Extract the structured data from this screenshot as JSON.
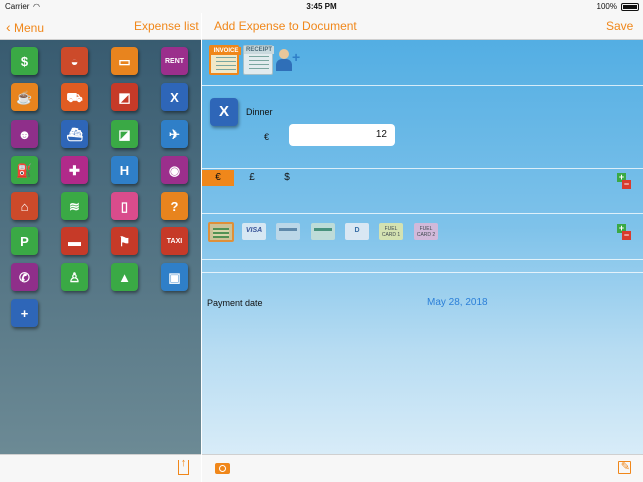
{
  "status": {
    "carrier": "Carrier",
    "time": "3:45 PM",
    "battery": "100%"
  },
  "left_nav": {
    "back_label": "Menu",
    "title": "Expense list"
  },
  "right_nav": {
    "title": "Add Expense to Document",
    "save_label": "Save"
  },
  "expense": {
    "name": "Dinner",
    "currency_symbol": "€",
    "amount": "12"
  },
  "documents": {
    "invoice_label": "INVOICE",
    "receipt_label": "RECEIPT"
  },
  "currencies": [
    "€",
    "£",
    "$"
  ],
  "payment_methods": [
    "cash",
    "VISA",
    "card",
    "card",
    "D",
    "FUEL CARD 1",
    "FUEL CARD 2"
  ],
  "payment_date": {
    "label": "Payment date",
    "value": "May 28, 2018"
  },
  "colors": {
    "accent": "#f0871a",
    "date_blue": "#2b7fd8"
  },
  "category_tiles": [
    {
      "name": "money-tile",
      "glyph": "$",
      "color": "#3aa945"
    },
    {
      "name": "bakery-tile",
      "glyph": "◒",
      "color": "#cc4a2a"
    },
    {
      "name": "bus-tile",
      "glyph": "▭",
      "color": "#e8841e"
    },
    {
      "name": "rent-car-tile",
      "glyph": "RENT",
      "color": "#9b2f8c"
    },
    {
      "name": "coffee-tile",
      "glyph": "☕",
      "color": "#e8841e"
    },
    {
      "name": "shopping-cart-tile",
      "glyph": "⛟",
      "color": "#e05c22"
    },
    {
      "name": "toll-tile",
      "glyph": "◩",
      "color": "#c63a28"
    },
    {
      "name": "restaurant-tile",
      "glyph": "X",
      "color": "#2e66b8"
    },
    {
      "name": "theatre-tile",
      "glyph": "☻",
      "color": "#8f2f8a"
    },
    {
      "name": "ferry-tile",
      "glyph": "⛴",
      "color": "#2e66b8"
    },
    {
      "name": "parking-attendant-tile",
      "glyph": "◪",
      "color": "#3aa945"
    },
    {
      "name": "flight-tile",
      "glyph": "✈",
      "color": "#2f7fc8"
    },
    {
      "name": "fuel-tile",
      "glyph": "⛽",
      "color": "#3aa945"
    },
    {
      "name": "gift-tile",
      "glyph": "✚",
      "color": "#b12a8a"
    },
    {
      "name": "hotel-tile",
      "glyph": "H",
      "color": "#2f7fc8"
    },
    {
      "name": "telecom-tile",
      "glyph": "◉",
      "color": "#9b2f8c"
    },
    {
      "name": "laundry-tile",
      "glyph": "⌂",
      "color": "#cc4a2a"
    },
    {
      "name": "food-tile",
      "glyph": "≋",
      "color": "#3aa945"
    },
    {
      "name": "minibar-tile",
      "glyph": "▯",
      "color": "#d94c8c"
    },
    {
      "name": "other-tile",
      "glyph": "?",
      "color": "#e8841e"
    },
    {
      "name": "parking-tile",
      "glyph": "P",
      "color": "#3aa945"
    },
    {
      "name": "car-tile",
      "glyph": "▬",
      "color": "#c63a28"
    },
    {
      "name": "towing-tile",
      "glyph": "⚑",
      "color": "#c63a28"
    },
    {
      "name": "taxi-tile",
      "glyph": "TAXI",
      "color": "#c63a28"
    },
    {
      "name": "phone-tile",
      "glyph": "✆",
      "color": "#8f2f8a"
    },
    {
      "name": "person-tile",
      "glyph": "♙",
      "color": "#3aa945"
    },
    {
      "name": "highway-tile",
      "glyph": "▲",
      "color": "#3aa945"
    },
    {
      "name": "train-tile",
      "glyph": "▣",
      "color": "#2f7fc8"
    },
    {
      "name": "add-remove-tile",
      "glyph": "+",
      "color": "#2e66b8"
    }
  ]
}
